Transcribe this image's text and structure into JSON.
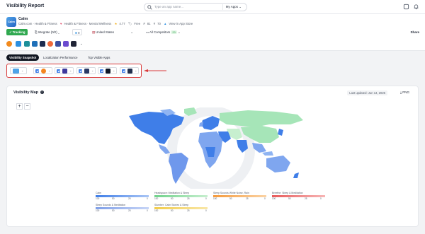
{
  "header": {
    "title": "Visibility Report",
    "search_placeholder": "Type an app name...",
    "my_apps_label": "My Apps"
  },
  "app": {
    "logo_text": "Calm",
    "name": "Calm",
    "meta": {
      "publisher": "Calm.com · Health & Fitness",
      "categories": "Health & Fitness · Mental Wellness",
      "rating": "4.77",
      "price": "Free",
      "count1": "81",
      "count2": "70",
      "store_link": "View in App Store"
    }
  },
  "controls": {
    "tracking_label": "Tracking",
    "integrate_label": "Integrate (0/2)",
    "country_label": "United States",
    "competitors_label": "All Competitors",
    "competitors_count": "20",
    "share_label": "Share"
  },
  "tabs": [
    {
      "label": "Visibility Snapshot",
      "active": true
    },
    {
      "label": "Localization Performance",
      "active": false
    },
    {
      "label": "Top Visible Apps",
      "active": false
    }
  ],
  "app_icons": [
    {
      "name": "orange-app-icon",
      "color": "#f28a1e"
    },
    {
      "name": "blue-app-icon",
      "color": "#2c8fe0"
    },
    {
      "name": "teal-app-icon",
      "color": "#1c8f9a"
    },
    {
      "name": "cyan-app-icon",
      "color": "#1e6fb8"
    },
    {
      "name": "navy-app-icon",
      "color": "#1b2b4e"
    },
    {
      "name": "red-app-icon",
      "color": "#f06a3a"
    },
    {
      "name": "indigo-app-icon",
      "color": "#3b4fa0"
    },
    {
      "name": "purple-app-icon",
      "color": "#6b4bcf"
    },
    {
      "name": "dark-app-icon",
      "color": "#202436"
    }
  ],
  "selected_apps": [
    {
      "name": "calm",
      "color": "#4ea3e8"
    },
    {
      "name": "headspace",
      "color": "#f5851f"
    },
    {
      "name": "sleep-sounds",
      "color": "#3f3a9e"
    },
    {
      "name": "sleep-sounds-white-noise",
      "color": "#2a3a66"
    },
    {
      "name": "breethe",
      "color": "#101828"
    },
    {
      "name": "slumber",
      "color": "#22304e"
    }
  ],
  "map": {
    "title": "Visibility Map",
    "last_updated": "Last updated: Jun 14, 2025",
    "download_label": "PNG",
    "zoom_in": "+",
    "zoom_out": "−"
  },
  "legend": [
    {
      "name": "Calm",
      "color_from": "#a9c5f5",
      "color_to": "#3f7ee8",
      "ticks": [
        "100",
        "50",
        "25",
        "0"
      ]
    },
    {
      "name": "Headspace: Meditation & Sleep",
      "color_from": "#c7efcf",
      "color_to": "#6fd28a",
      "ticks": [
        "100",
        "50",
        "25",
        "0"
      ]
    },
    {
      "name": "Sleep Sounds White Noise, Rain",
      "color_from": "#fbd3a4",
      "color_to": "#f59a3c",
      "ticks": [
        "100",
        "50",
        "25",
        "0"
      ]
    },
    {
      "name": "Breethe: Sleep & Meditation",
      "color_from": "#f7b5b5",
      "color_to": "#e85a5a",
      "ticks": [
        "100",
        "50",
        "25",
        "0"
      ]
    },
    {
      "name": "Sleep Sounds & Meditation",
      "color_from": "#c7d5f7",
      "color_to": "#7f9fe8",
      "ticks": [
        "100",
        "50",
        "25",
        "0"
      ]
    },
    {
      "name": "Slumber: Calm Stories & Sleep",
      "color_from": "#f9e7a8",
      "color_to": "#f2cc4a",
      "ticks": [
        "100",
        "50",
        "25",
        "0"
      ]
    }
  ]
}
